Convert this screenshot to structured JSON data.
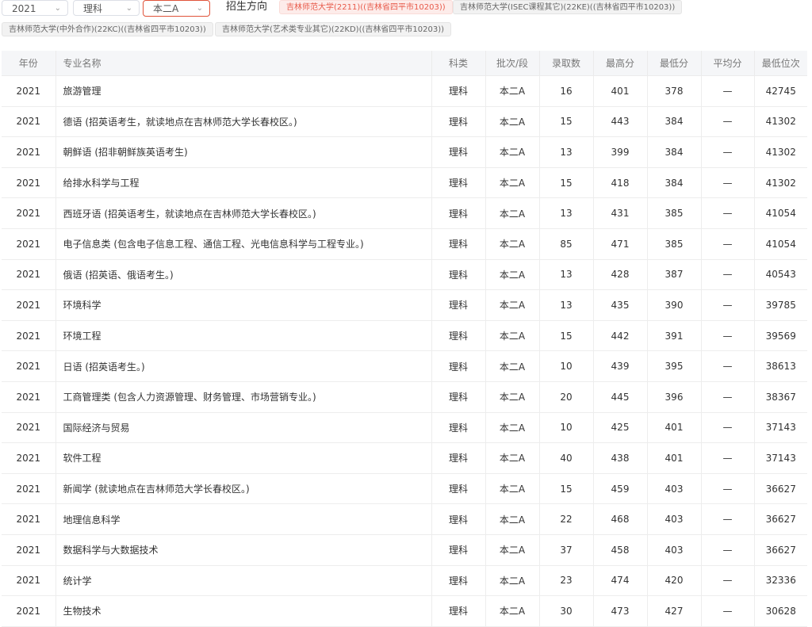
{
  "filters": {
    "year": "2021",
    "subject": "理科",
    "batch": "本二A",
    "direction_label": "招生方向",
    "tags": [
      {
        "text": "吉林师范大学(2211)((吉林省四平市10203))",
        "active": true
      },
      {
        "text": "吉林师范大学(ISEC课程其它)(22KE)((吉林省四平市10203))",
        "active": false
      },
      {
        "text": "吉林师范大学(中外合作)(22KC)((吉林省四平市10203))",
        "active": false
      },
      {
        "text": "吉林师范大学(艺术类专业其它)(22KD)((吉林省四平市10203))",
        "active": false
      }
    ]
  },
  "table": {
    "headers": [
      "年份",
      "专业名称",
      "科类",
      "批次/段",
      "录取数",
      "最高分",
      "最低分",
      "平均分",
      "最低位次"
    ],
    "rows": [
      [
        "2021",
        "旅游管理",
        "理科",
        "本二A",
        "16",
        "401",
        "378",
        "—",
        "42745"
      ],
      [
        "2021",
        "德语 (招英语考生，就读地点在吉林师范大学长春校区。)",
        "理科",
        "本二A",
        "15",
        "443",
        "384",
        "—",
        "41302"
      ],
      [
        "2021",
        "朝鲜语 (招非朝鲜族英语考生)",
        "理科",
        "本二A",
        "13",
        "399",
        "384",
        "—",
        "41302"
      ],
      [
        "2021",
        "给排水科学与工程",
        "理科",
        "本二A",
        "15",
        "418",
        "384",
        "—",
        "41302"
      ],
      [
        "2021",
        "西班牙语 (招英语考生，就读地点在吉林师范大学长春校区。)",
        "理科",
        "本二A",
        "13",
        "431",
        "385",
        "—",
        "41054"
      ],
      [
        "2021",
        "电子信息类 (包含电子信息工程、通信工程、光电信息科学与工程专业。)",
        "理科",
        "本二A",
        "85",
        "471",
        "385",
        "—",
        "41054"
      ],
      [
        "2021",
        "俄语 (招英语、俄语考生。)",
        "理科",
        "本二A",
        "13",
        "428",
        "387",
        "—",
        "40543"
      ],
      [
        "2021",
        "环境科学",
        "理科",
        "本二A",
        "13",
        "435",
        "390",
        "—",
        "39785"
      ],
      [
        "2021",
        "环境工程",
        "理科",
        "本二A",
        "15",
        "442",
        "391",
        "—",
        "39569"
      ],
      [
        "2021",
        "日语 (招英语考生。)",
        "理科",
        "本二A",
        "10",
        "439",
        "395",
        "—",
        "38613"
      ],
      [
        "2021",
        "工商管理类 (包含人力资源管理、财务管理、市场营销专业。)",
        "理科",
        "本二A",
        "20",
        "445",
        "396",
        "—",
        "38367"
      ],
      [
        "2021",
        "国际经济与贸易",
        "理科",
        "本二A",
        "10",
        "425",
        "401",
        "—",
        "37143"
      ],
      [
        "2021",
        "软件工程",
        "理科",
        "本二A",
        "40",
        "438",
        "401",
        "—",
        "37143"
      ],
      [
        "2021",
        "新闻学 (就读地点在吉林师范大学长春校区。)",
        "理科",
        "本二A",
        "15",
        "459",
        "403",
        "—",
        "36627"
      ],
      [
        "2021",
        "地理信息科学",
        "理科",
        "本二A",
        "22",
        "468",
        "403",
        "—",
        "36627"
      ],
      [
        "2021",
        "数据科学与大数据技术",
        "理科",
        "本二A",
        "37",
        "458",
        "403",
        "—",
        "36627"
      ],
      [
        "2021",
        "统计学",
        "理科",
        "本二A",
        "23",
        "474",
        "420",
        "—",
        "32336"
      ],
      [
        "2021",
        "生物技术",
        "理科",
        "本二A",
        "30",
        "473",
        "427",
        "—",
        "30628"
      ]
    ]
  },
  "icons": {
    "dropdown": "chevron-down-icon"
  },
  "colors": {
    "accent": "#e0533a",
    "tag_active_bg": "#fdecea",
    "header_bg": "#f5f6f8"
  }
}
